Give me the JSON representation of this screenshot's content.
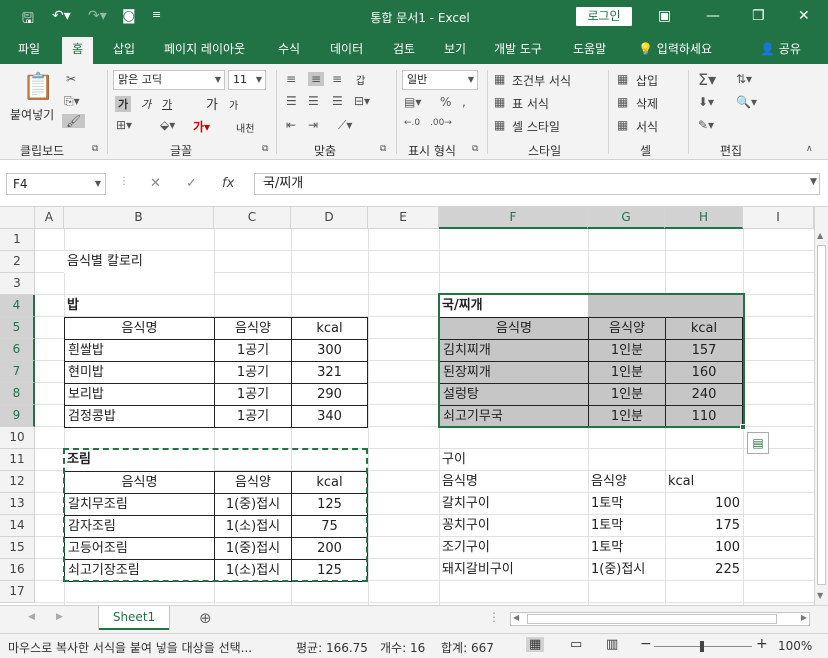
{
  "titlebar": {
    "title": "통합 문서1  -  Excel",
    "login": "로그인",
    "minimize": "—",
    "restore": "❐",
    "close": "✕"
  },
  "menu": {
    "tabs": [
      "파일",
      "홈",
      "삽입",
      "페이지 레이아웃",
      "수식",
      "데이터",
      "검토",
      "보기",
      "개발 도구",
      "도움말"
    ],
    "search": "입력하세요",
    "share": "공유"
  },
  "ribbon": {
    "clipboard": {
      "paste": "붙여넣기",
      "label": "클립보드"
    },
    "font": {
      "name": "맑은 고딕",
      "size": "11",
      "label": "글꼴",
      "bold": "가",
      "italic": "가",
      "underline": "가",
      "grow": "가",
      "shrink": "가",
      "phonetic": "내천"
    },
    "align": {
      "label": "맞춤",
      "wrap": "갑"
    },
    "number": {
      "format": "일반",
      "label": "표시 형식"
    },
    "style": {
      "conditional": "조건부 서식",
      "table": "표 서식",
      "cell": "셀 스타일",
      "label": "스타일"
    },
    "cells": {
      "insert": "삽입",
      "delete": "삭제",
      "format": "서식",
      "label": "셀"
    },
    "edit": {
      "label": "편집"
    }
  },
  "formula": {
    "namebox": "F4",
    "content": "국/찌개"
  },
  "columns": [
    "A",
    "B",
    "C",
    "D",
    "E",
    "F",
    "G",
    "H",
    "I"
  ],
  "rows": [
    "1",
    "2",
    "3",
    "4",
    "5",
    "6",
    "7",
    "8",
    "9",
    "10",
    "11",
    "12",
    "13",
    "14",
    "15",
    "16",
    "17"
  ],
  "sheet": {
    "title": "음식별 칼로리",
    "rice": {
      "heading": "밥",
      "headers": [
        "음식명",
        "음식양",
        "kcal"
      ],
      "items": [
        [
          "흰쌀밥",
          "1공기",
          "300"
        ],
        [
          "현미밥",
          "1공기",
          "321"
        ],
        [
          "보리밥",
          "1공기",
          "290"
        ],
        [
          "검정콩밥",
          "1공기",
          "340"
        ]
      ]
    },
    "soup": {
      "heading": "국/찌개",
      "headers": [
        "음식명",
        "음식양",
        "kcal"
      ],
      "items": [
        [
          "김치찌개",
          "1인분",
          "157"
        ],
        [
          "된장찌개",
          "1인분",
          "160"
        ],
        [
          "설렁탕",
          "1인분",
          "240"
        ],
        [
          "쇠고기무국",
          "1인분",
          "110"
        ]
      ]
    },
    "braised": {
      "heading": "조림",
      "headers": [
        "음식명",
        "음식양",
        "kcal"
      ],
      "items": [
        [
          "갈치무조림",
          "1(중)접시",
          "125"
        ],
        [
          "감자조림",
          "1(소)접시",
          "75"
        ],
        [
          "고등어조림",
          "1(중)접시",
          "200"
        ],
        [
          "쇠고기장조림",
          "1(소)접시",
          "125"
        ]
      ]
    },
    "grill": {
      "heading": "구이",
      "headers": [
        "음식명",
        "음식양",
        "kcal"
      ],
      "items": [
        [
          "갈치구이",
          "1토막",
          "100"
        ],
        [
          "꽁치구이",
          "1토막",
          "175"
        ],
        [
          "조기구이",
          "1토막",
          "100"
        ],
        [
          "돼지갈비구이",
          "1(중)접시",
          "225"
        ]
      ]
    }
  },
  "tabs": {
    "sheet1": "Sheet1"
  },
  "status": {
    "message": "마우스로 복사한 서식을 붙여 넣을 대상을 선택...",
    "average": "평균: 166.75",
    "count": "개수: 16",
    "sum": "합계: 667",
    "zoom": "100%"
  },
  "colors": {
    "accent": "#217346",
    "selection_gray": "#c6c6c6"
  }
}
